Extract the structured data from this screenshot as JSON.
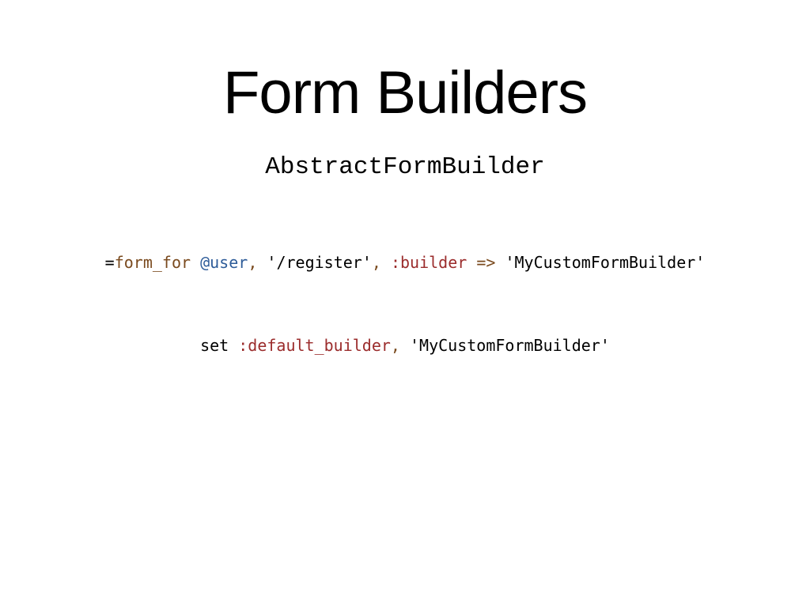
{
  "slide": {
    "title": "Form Builders",
    "subtitle": "AbstractFormBuilder",
    "code_line_1": [
      {
        "text": "=",
        "color": "#000000"
      },
      {
        "text": "form_for",
        "color": "#7a4a1e"
      },
      {
        "text": " ",
        "color": "#000000"
      },
      {
        "text": "@user",
        "color": "#2e5c99"
      },
      {
        "text": ", ",
        "color": "#7a4a1e"
      },
      {
        "text": "'/register'",
        "color": "#000000"
      },
      {
        "text": ", ",
        "color": "#7a4a1e"
      },
      {
        "text": ":builder",
        "color": "#9b2c2c"
      },
      {
        "text": " => ",
        "color": "#7a4a1e"
      },
      {
        "text": "'MyCustomFormBuilder'",
        "color": "#000000"
      }
    ],
    "code_line_2": [
      {
        "text": "set ",
        "color": "#000000"
      },
      {
        "text": ":default_builder",
        "color": "#9b2c2c"
      },
      {
        "text": ", ",
        "color": "#7a4a1e"
      },
      {
        "text": "'MyCustomFormBuilder'",
        "color": "#000000"
      }
    ]
  }
}
